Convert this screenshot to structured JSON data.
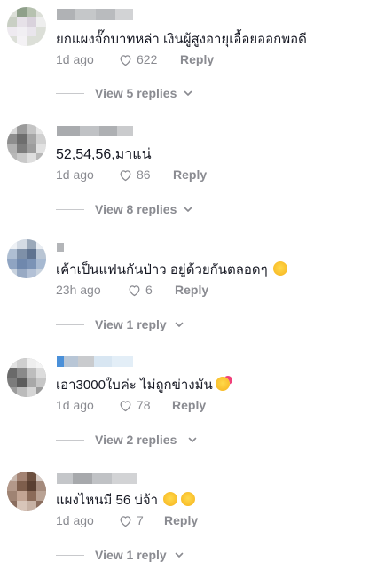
{
  "comments": [
    {
      "text": "ยกแผงจั๊กบาทหล่า เงินผู้สูงอายุเอื้อยออกพอดี",
      "time": "1d ago",
      "likes": "622",
      "reply_label": "Reply",
      "view_replies": "View 5 replies"
    },
    {
      "text": "52,54,56,มาแน่",
      "time": "1d ago",
      "likes": "86",
      "reply_label": "Reply",
      "view_replies": "View 8 replies"
    },
    {
      "text": "เค้าเป็นแฟนกันป่าว อยู่ด้วยกันตลอดๆ",
      "time": "23h ago",
      "likes": "6",
      "reply_label": "Reply",
      "view_replies": "View 1 reply"
    },
    {
      "text": "เอา3000ใบค่ะ ไม่ถูกข่างมัน",
      "time": "1d ago",
      "likes": "78",
      "reply_label": "Reply",
      "view_replies": "View 2 replies"
    },
    {
      "text": "แผงไหนมี 56 บ่จ้า",
      "time": "1d ago",
      "likes": "7",
      "reply_label": "Reply",
      "view_replies": "View 1 reply"
    }
  ],
  "colors": {
    "text": "#161823",
    "muted": "#8a8b91",
    "divider": "#c8c9cc"
  },
  "icons": {
    "like": "heart-outline-icon",
    "expand": "chevron-down-icon",
    "emoji_smile": "smiling-face-emoji",
    "emoji_hearts": "smiling-face-with-hearts-emoji",
    "emoji_grin": "grinning-face-emoji",
    "emoji_sweat": "grinning-face-with-sweat-emoji"
  }
}
